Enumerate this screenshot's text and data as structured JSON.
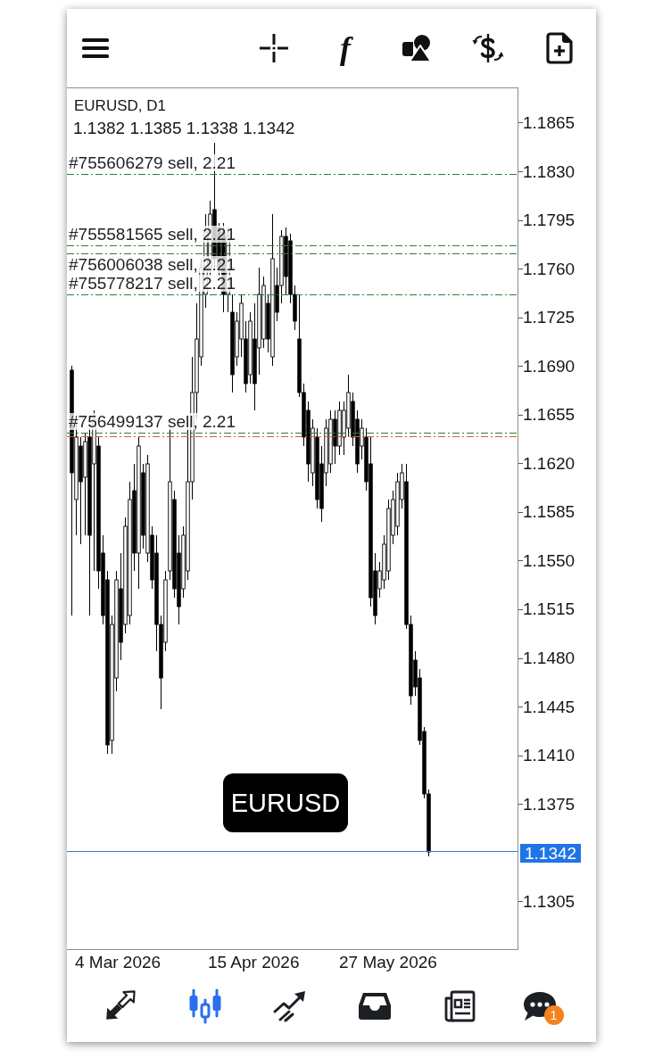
{
  "toolbar": {
    "indicator_glyph": "f"
  },
  "chart": {
    "symbol_period": "EURUSD, D1",
    "ohlc": "1.1382 1.1385 1.1338 1.1342",
    "caption": "EURUSD",
    "order_lines": [
      {
        "label": "#755606279 sell, 2.21",
        "color": "#2e7d32"
      },
      {
        "label": "#755581565 sell, 2.21",
        "color": "#2e7d32"
      },
      {
        "label": "#756006038 sell, 2.21",
        "color": "#2e7d32"
      },
      {
        "label": "#755778217 sell, 2.21",
        "color": "#2e7d32"
      },
      {
        "label": "#756499137 sell, 2.21",
        "color": "#2e7d32"
      },
      {
        "color": "#e0542c"
      }
    ]
  },
  "price_axis": [
    {
      "label": "1.1865",
      "kind": "tick"
    },
    {
      "label": "1.1830",
      "kind": "tick"
    },
    {
      "label": "1.1795",
      "kind": "tick"
    },
    {
      "label": "1.1760",
      "kind": "tick"
    },
    {
      "label": "1.1725",
      "kind": "tick"
    },
    {
      "label": "1.1690",
      "kind": "tick"
    },
    {
      "label": "1.1655",
      "kind": "tick"
    },
    {
      "label": "1.1620",
      "kind": "tick"
    },
    {
      "label": "1.1585",
      "kind": "tick"
    },
    {
      "label": "1.1550",
      "kind": "tick"
    },
    {
      "label": "1.1515",
      "kind": "tick"
    },
    {
      "label": "1.1480",
      "kind": "tick"
    },
    {
      "label": "1.1445",
      "kind": "tick"
    },
    {
      "label": "1.1410",
      "kind": "tick"
    },
    {
      "label": "1.1375",
      "kind": "tick"
    },
    {
      "label": "1.1342",
      "kind": "current"
    },
    {
      "label": "1.1305",
      "kind": "tick"
    }
  ],
  "date_axis": [
    "4 Mar 2026",
    "15 Apr 2026",
    "27 May 2026"
  ],
  "bottom_nav": [
    {
      "selected": false
    },
    {
      "selected": true
    },
    {
      "selected": false
    },
    {
      "selected": false
    },
    {
      "selected": false
    },
    {
      "selected": false,
      "badge": "1"
    }
  ]
}
